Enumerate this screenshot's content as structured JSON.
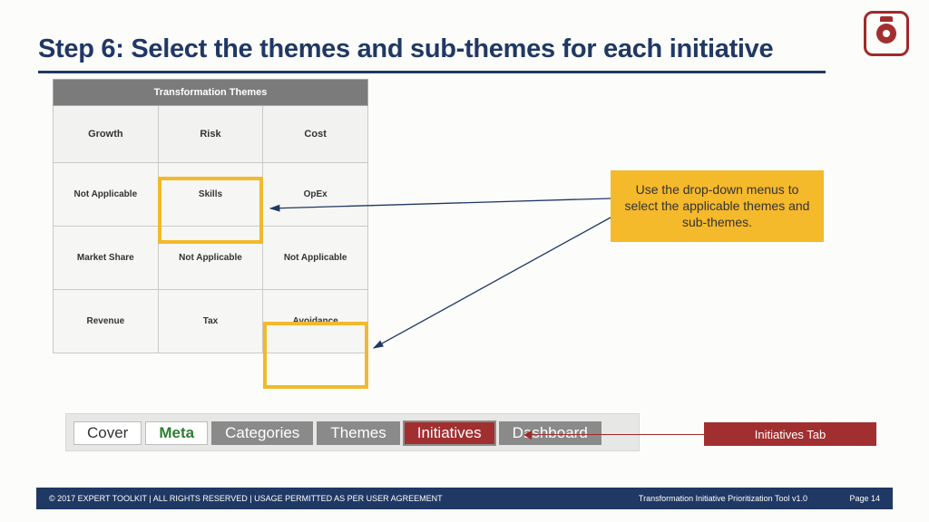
{
  "title": "Step 6: Select the themes and sub-themes for each initiative",
  "table": {
    "header": "Transformation Themes",
    "cols": [
      "Growth",
      "Risk",
      "Cost"
    ],
    "rows": [
      [
        "Not Applicable",
        "Skills",
        "OpEx"
      ],
      [
        "Market Share",
        "Not Applicable",
        "Not Applicable"
      ],
      [
        "Revenue",
        "Tax",
        "Avoidance"
      ]
    ]
  },
  "callout": "Use the drop-down menus to select the applicable themes and sub-themes.",
  "tabs": {
    "cover": "Cover",
    "meta": "Meta",
    "categories": "Categories",
    "themes": "Themes",
    "initiatives": "Initiatives",
    "dashboard": "Dashboard"
  },
  "tab_label": "Initiatives Tab",
  "footer": {
    "left": "© 2017 EXPERT TOOLKIT | ALL RIGHTS RESERVED | USAGE PERMITTED AS PER USER AGREEMENT",
    "mid": "Transformation Initiative Prioritization Tool v1.0",
    "page": "Page 14"
  }
}
